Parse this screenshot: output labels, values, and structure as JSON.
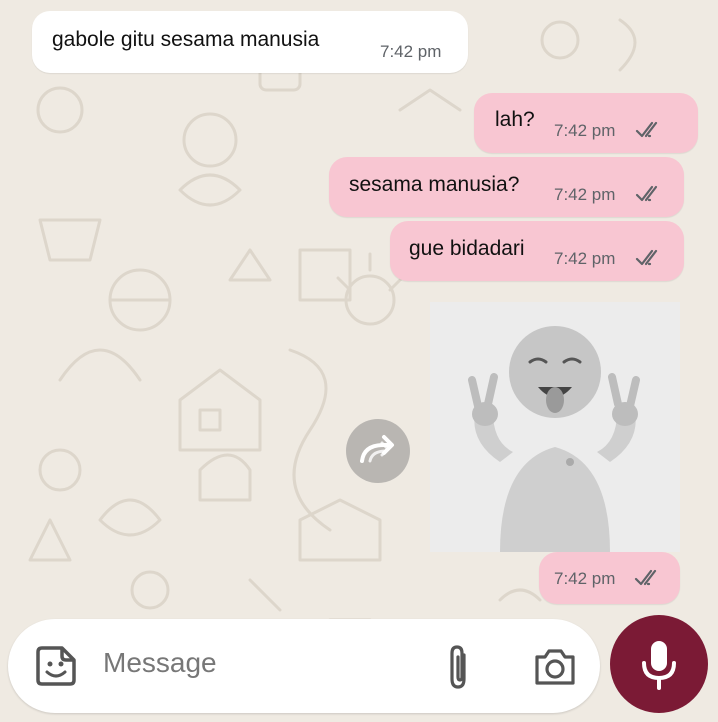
{
  "theme": {
    "chat_background": "#efeae2",
    "incoming_bubble": "#ffffff",
    "outgoing_bubble": "#f8c6d2",
    "accent": "#7b1a35",
    "tick_color": "#5f6368"
  },
  "messages": [
    {
      "direction": "incoming",
      "text": "gabole gitu sesama manusia",
      "time": "7:42 pm"
    },
    {
      "direction": "outgoing",
      "text": "lah?",
      "time": "7:42 pm",
      "status": "read-double-check"
    },
    {
      "direction": "outgoing",
      "text": "sesama manusia?",
      "time": "7:42 pm",
      "status": "read-double-check"
    },
    {
      "direction": "outgoing",
      "text": "gue bidadari",
      "time": "7:42 pm",
      "status": "read-double-check"
    },
    {
      "direction": "outgoing",
      "type": "image",
      "image_description": "grayscale-baby-peace-signs-photo",
      "time": "7:42 pm",
      "status": "read-double-check"
    }
  ],
  "actions": {
    "forward_icon": "forward-arrow-icon"
  },
  "composer": {
    "placeholder": "Message",
    "left_icon": "sticker-icon",
    "attach_icon": "paperclip-icon",
    "camera_icon": "camera-icon",
    "send_icon": "microphone-icon"
  }
}
